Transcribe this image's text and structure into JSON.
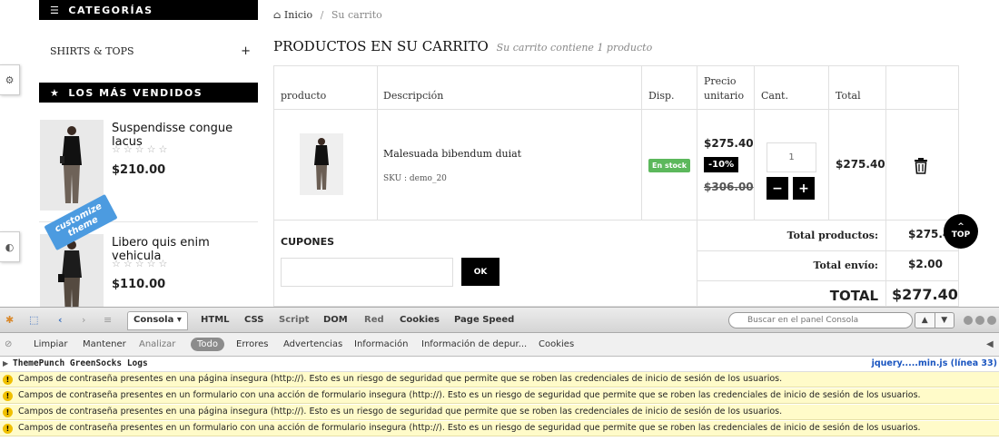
{
  "sidebar": {
    "categories_title": "CATEGORÍAS",
    "category_item": "SHIRTS & TOPS",
    "category_toggle": "+",
    "bestsellers_title": "LOS MÁS VENDIDOS",
    "products": [
      {
        "name": "Suspendisse congue lacus",
        "stars": "☆☆☆☆☆",
        "price": "$210.00"
      },
      {
        "name": "Libero quis enim vehicula",
        "stars": "☆☆☆☆☆",
        "price": "$110.00"
      }
    ],
    "customize_label_1": "customize",
    "customize_label_2": "theme"
  },
  "breadcrumb": {
    "home": "Inicio",
    "separator": "/",
    "current": "Su carrito"
  },
  "heading": {
    "title": "PRODUCTOS EN SU CARRITO",
    "subtitle": "Su carrito contiene 1 producto"
  },
  "cart": {
    "headers": {
      "product": "producto",
      "description": "Descripción",
      "availability": "Disp.",
      "unit_price_1": "Precio",
      "unit_price_2": "unitario",
      "quantity": "Cant.",
      "total": "Total"
    },
    "item": {
      "name": "Malesuada bibendum duiat",
      "sku": "SKU : demo_20",
      "stock": "En stock",
      "price": "$275.40",
      "discount": "-10%",
      "old_price": "$306.00",
      "quantity": "1",
      "minus": "−",
      "plus": "+",
      "total": "$275.40"
    },
    "coupons_label": "CUPONES",
    "coupon_button": "OK",
    "summary": {
      "products_label": "Total productos:",
      "products_value": "$275.40",
      "shipping_label": "Total envío:",
      "shipping_value": "$2.00",
      "total_label": "TOTAL",
      "total_value": "$277.40"
    }
  },
  "top_button": {
    "label": "TOP"
  },
  "firebug": {
    "tabs": [
      "Consola",
      "HTML",
      "CSS",
      "Script",
      "DOM",
      "Red",
      "Cookies",
      "Page Speed"
    ],
    "console_arrow": "▾",
    "search_placeholder": "Buscar en el panel Consola",
    "filters": [
      "Limpiar",
      "Mantener",
      "Analizar",
      "Todo",
      "Errores",
      "Advertencias",
      "Información",
      "Información de depur...",
      "Cookies"
    ],
    "log_header": "ThemePunch GreenSocks Logs",
    "log_source": "jquery.....min.js (línea 33)",
    "warnings": [
      "Campos de contraseña presentes en una página insegura (http://). Esto es un riesgo de seguridad que permite que se roben las credenciales de inicio de sesión de los usuarios.",
      "Campos de contraseña presentes en un formulario con una acción de formulario insegura (http://). Esto es un riesgo de seguridad que permite que se roben las credenciales de inicio de sesión de los usuarios.",
      "Campos de contraseña presentes en una página insegura (http://). Esto es un riesgo de seguridad que permite que se roben las credenciales de inicio de sesión de los usuarios.",
      "Campos de contraseña presentes en un formulario con una acción de formulario insegura (http://). Esto es un riesgo de seguridad que permite que se roben las credenciales de inicio de sesión de los usuarios."
    ]
  },
  "icons": {
    "menu": "menu-icon",
    "star": "star-icon",
    "home": "home-icon",
    "trash": "trash-icon",
    "gear": "gear-icon",
    "contrast": "contrast-icon",
    "search": "search-icon",
    "warning": "warning-icon"
  },
  "colors": {
    "accent": "#000000",
    "stock_badge": "#5cb85c",
    "customize_ribbon": "#4c9be0",
    "warning_row": "#fffbc9",
    "link": "#1a55c0"
  }
}
